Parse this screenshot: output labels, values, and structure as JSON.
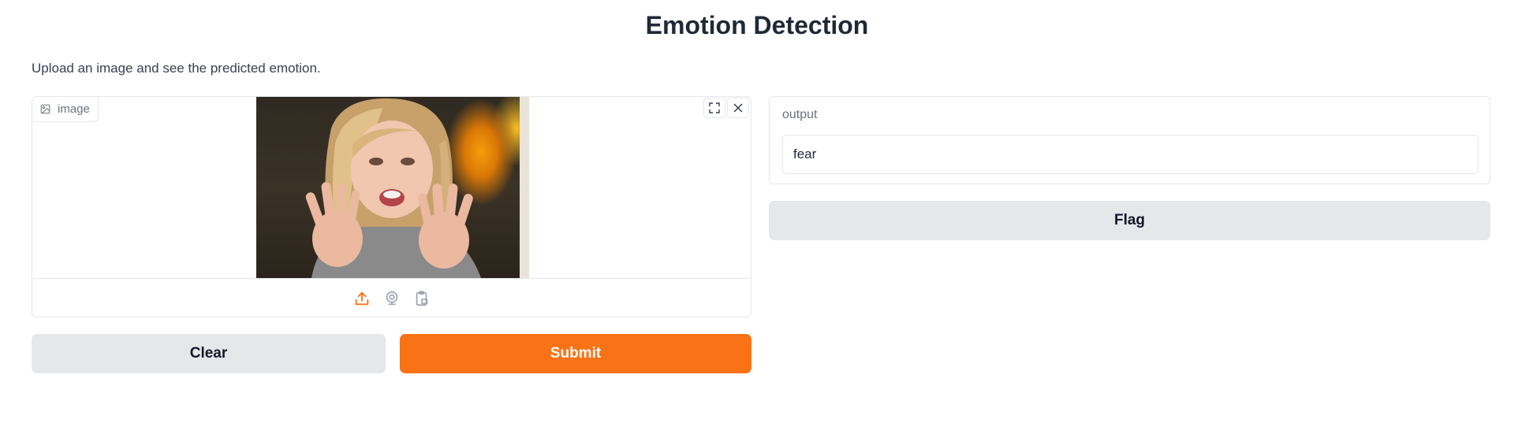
{
  "header": {
    "title": "Emotion Detection",
    "description": "Upload an image and see the predicted emotion."
  },
  "image_input": {
    "label": "image",
    "icons": {
      "label_icon": "image-icon",
      "fullscreen": "fullscreen-icon",
      "clear": "close-icon"
    },
    "sources": [
      "upload-icon",
      "webcam-icon",
      "clipboard-icon"
    ]
  },
  "actions": {
    "clear_label": "Clear",
    "submit_label": "Submit",
    "flag_label": "Flag"
  },
  "output": {
    "label": "output",
    "value": "fear"
  },
  "colors": {
    "accent": "#f97316",
    "secondary_button": "#e5e7eb",
    "border": "#e5e7eb"
  }
}
